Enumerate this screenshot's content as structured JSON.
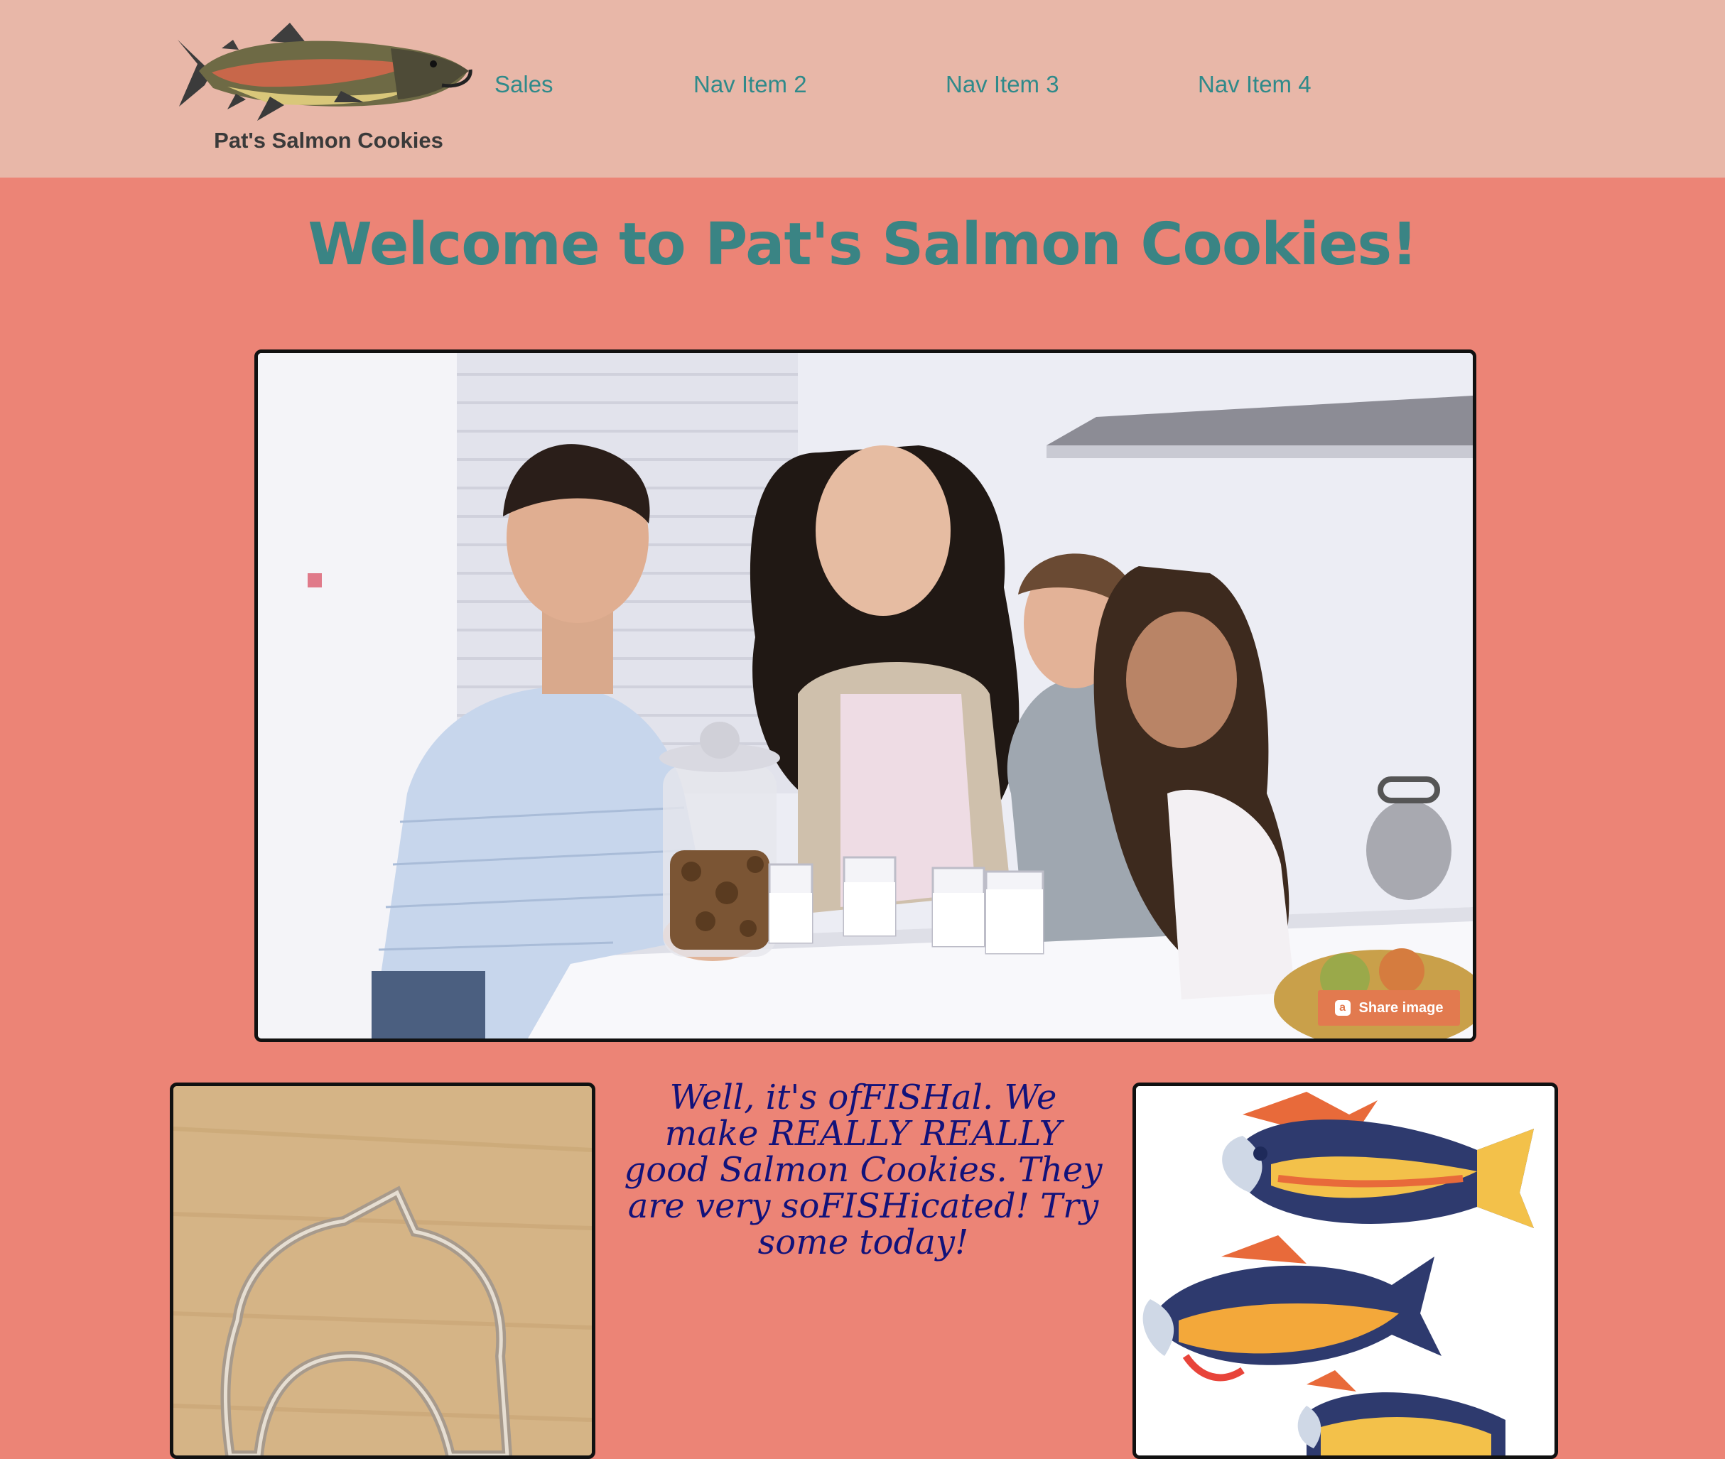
{
  "header": {
    "logo_text": "Pat's Salmon Cookies",
    "nav": [
      {
        "label": "Sales"
      },
      {
        "label": "Nav Item 2"
      },
      {
        "label": "Nav Item 3"
      },
      {
        "label": "Nav Item 4"
      }
    ]
  },
  "main": {
    "headline": "Welcome to Pat's Salmon Cookies!",
    "hero": {
      "share_label": "Share image"
    },
    "tagline": "Well, it's ofFISHal. We make REALLY REALLY good Salmon Cookies. They are very soFISHicated! Try some today!"
  },
  "colors": {
    "header_bg": "#E8B7A8",
    "page_bg": "#EC8476",
    "accent_teal": "#3A8484",
    "tagline_navy": "#12127A",
    "share_orange": "#E27A4F"
  }
}
